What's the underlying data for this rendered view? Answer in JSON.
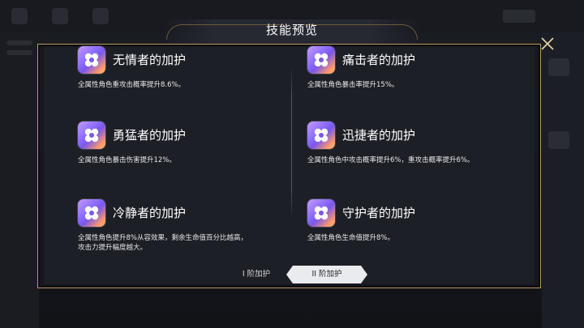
{
  "dialog": {
    "title": "技能预览"
  },
  "skills": [
    {
      "name": "无情者的加护",
      "desc": "全属性角色重攻击概率提升8.6%。"
    },
    {
      "name": "痛击者的加护",
      "desc": "全属性角色暴击率提升15%。"
    },
    {
      "name": "勇猛者的加护",
      "desc": "全属性角色暴击伤害提升12%。"
    },
    {
      "name": "迅捷者的加护",
      "desc": "全属性角色中攻击概率提升6%，重攻击概率提升6%。"
    },
    {
      "name": "冷静者的加护",
      "desc_line1": "全属性角色提升8%从容效果，剩余生命值百分比越高，",
      "desc_line2": "攻击力提升幅度越大。"
    },
    {
      "name": "守护者的加护",
      "desc": "全属性角色生命值提升8%。"
    }
  ],
  "tabs": [
    {
      "label": "I 阶加护",
      "selected": false
    },
    {
      "label": "II 阶加护",
      "selected": true
    }
  ],
  "icons": {
    "skill_icon": "flower-badge-icon",
    "close": "close-icon"
  },
  "colors": {
    "frame_gold": "#b89a62",
    "selected_tab_bg": "#e9ebef"
  }
}
